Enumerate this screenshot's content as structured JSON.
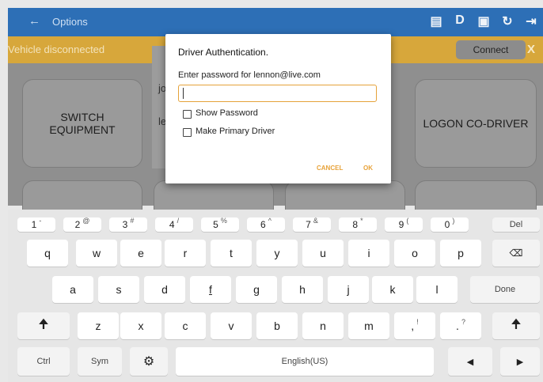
{
  "appbar": {
    "back_icon": "arrow-left",
    "title": "Options",
    "icons": [
      "message-icon",
      "driver-d-icon",
      "computer-icon",
      "refresh-icon",
      "logout-icon"
    ],
    "icon_glyphs": [
      "▤",
      "D",
      "▣",
      "↻",
      "⇥"
    ]
  },
  "vehicle_bar": {
    "status": "Vehicle disconnected",
    "connect_label": "Connect",
    "close_label": "X"
  },
  "tiles": {
    "switch_equipment": "SWITCH\nEQUIPMENT",
    "logon_codriver": "LOGON CO-DRIVER"
  },
  "background_dialog": {
    "row1": "jo",
    "row2": "le"
  },
  "dialog": {
    "title": "Driver Authentication.",
    "prompt": "Enter password for lennon@live.com",
    "password_value": "",
    "show_password_label": "Show Password",
    "primary_driver_label": "Make Primary Driver",
    "cancel_label": "CANCEL",
    "ok_label": "OK"
  },
  "keyboard": {
    "numbers": [
      {
        "k": "1",
        "s": "-"
      },
      {
        "k": "2",
        "s": "@"
      },
      {
        "k": "3",
        "s": "#"
      },
      {
        "k": "4",
        "s": "/"
      },
      {
        "k": "5",
        "s": "%"
      },
      {
        "k": "6",
        "s": "^"
      },
      {
        "k": "7",
        "s": "&"
      },
      {
        "k": "8",
        "s": "*"
      },
      {
        "k": "9",
        "s": "("
      },
      {
        "k": "0",
        "s": ")"
      }
    ],
    "del_label": "Del",
    "row_q": [
      "q",
      "w",
      "e",
      "r",
      "t",
      "y",
      "u",
      "i",
      "o",
      "p"
    ],
    "row_a": [
      "a",
      "s",
      "d",
      "f",
      "g",
      "h",
      "j",
      "k",
      "l"
    ],
    "done_label": "Done",
    "row_z": [
      "z",
      "x",
      "c",
      "v",
      "b",
      "n",
      "m"
    ],
    "comma": {
      "k": ",",
      "s": "!"
    },
    "period": {
      "k": ".",
      "s": "?"
    },
    "ctrl_label": "Ctrl",
    "sym_label": "Sym",
    "space_label": "English(US)"
  }
}
